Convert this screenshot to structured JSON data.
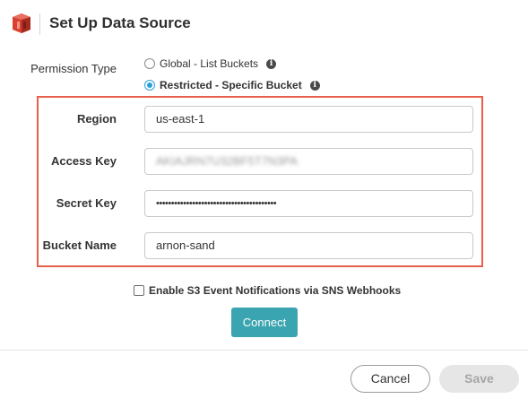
{
  "header": {
    "title": "Set Up Data Source",
    "logo_icon": "amazon-s3-logo"
  },
  "permission": {
    "label": "Permission Type",
    "options": [
      {
        "label": "Global - List Buckets",
        "selected": false
      },
      {
        "label": "Restricted - Specific Bucket",
        "selected": true
      }
    ],
    "info_icon": "info-icon",
    "info_glyph": "i"
  },
  "fields": {
    "region": {
      "label": "Region",
      "value": "us-east-1"
    },
    "access_key": {
      "label": "Access Key",
      "value": "AKIAJRN7U32BF5T7N3PA"
    },
    "secret_key": {
      "label": "Secret Key",
      "value": "••••••••••••••••••••••••••••••••••••••••"
    },
    "bucket_name": {
      "label": "Bucket Name",
      "value": "arnon-sand"
    }
  },
  "sns_checkbox": {
    "label": "Enable S3 Event Notifications via SNS Webhooks",
    "checked": false
  },
  "actions": {
    "connect_label": "Connect",
    "cancel_label": "Cancel",
    "save_label": "Save"
  },
  "colors": {
    "accent": "#3aa4b0",
    "highlight_border": "#e8604c",
    "radio_selected": "#2a9fd8",
    "logo": "#d9402f"
  }
}
